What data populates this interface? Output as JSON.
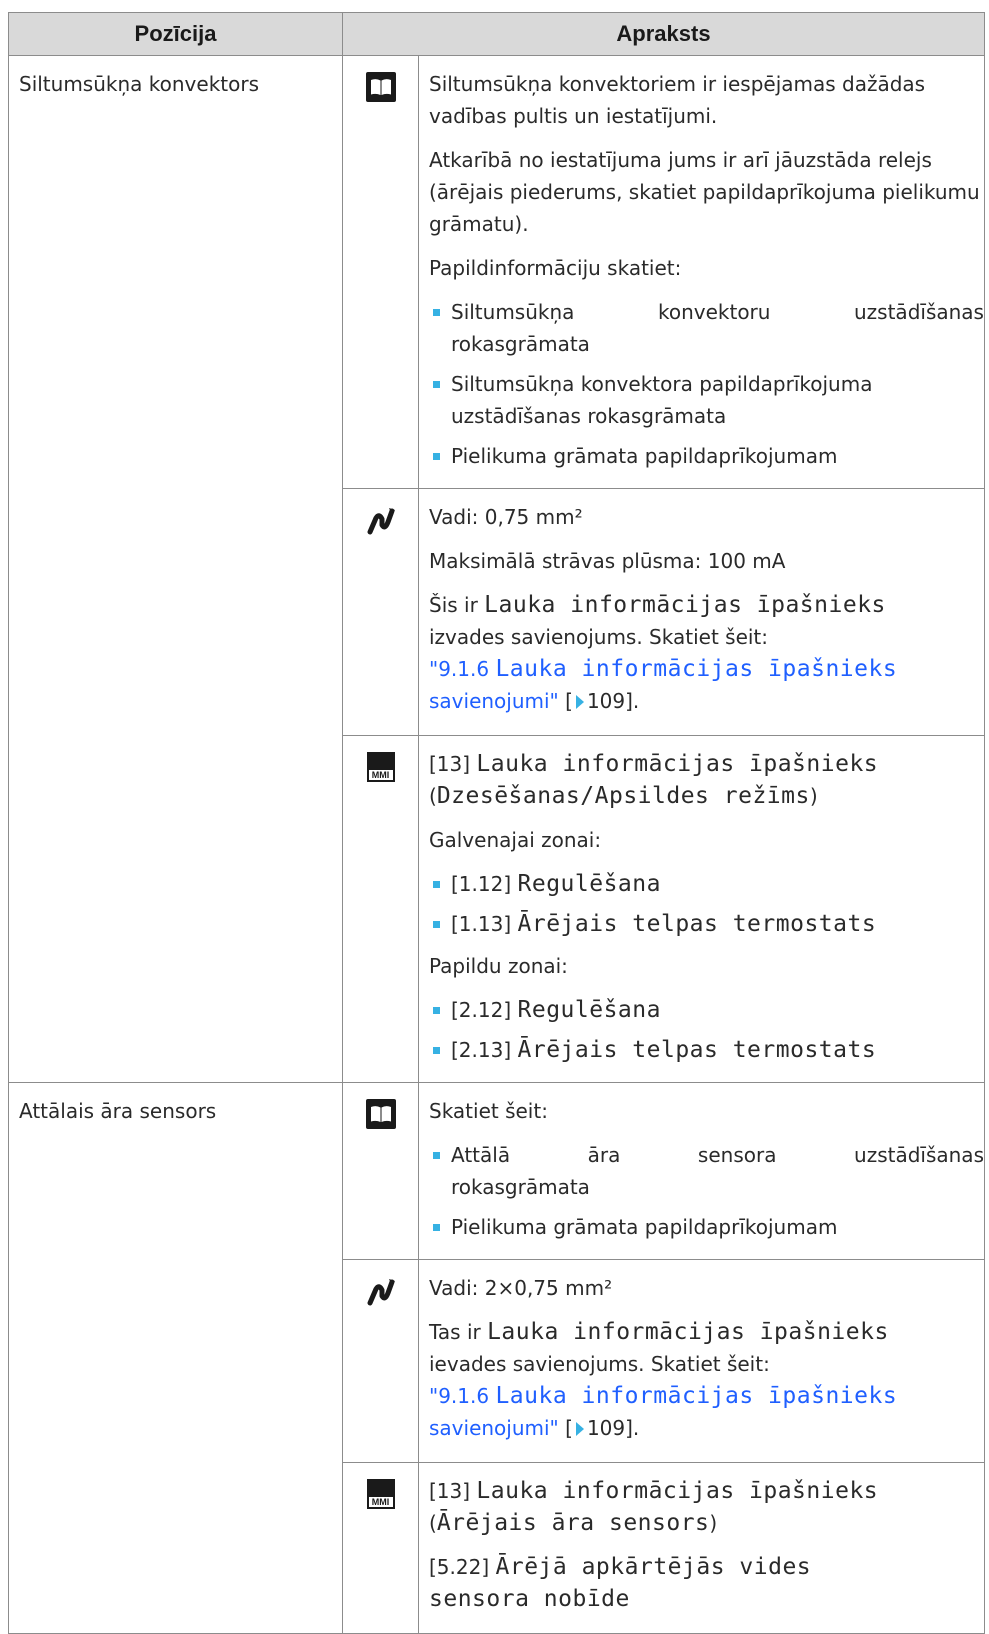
{
  "header": {
    "col1": "Pozīcija",
    "col2": "Apraksts"
  },
  "rows": [
    {
      "position": "Siltumsūkņa konvektors",
      "manual": {
        "icon": "manual-book-icon",
        "p1": "Siltumsūkņa konvektoriem ir iespējamas dažādas vadības pultis un iestatījumi.",
        "p2": "Atkarībā no iestatījuma jums ir arī jāuzstāda relejs (ārējais piederums, skatiet papildaprīkojuma pielikumu grāmatu).",
        "p3": "Papildinformāciju skatiet:",
        "b1a": "Siltumsūkņa",
        "b1b": "konvektoru",
        "b1c": "uzstādīšanas",
        "b1d": "rokasgrāmata",
        "b2a": "Siltumsūkņa konvektora papildaprīkojuma",
        "b2b": "uzstādīšanas rokasgrāmata",
        "b3": "Pielikuma grāmata papildaprīkojumam"
      },
      "wiring": {
        "icon": "wiring-icon",
        "wires": "Vadi: 0,75 mm²",
        "current": "Maksimālā strāvas plūsma: 100 mA",
        "this_is": "Šis ir",
        "field": "Lauka informācijas īpašnieks",
        "conn": "izvades savienojums. Skatiet šeit:",
        "link_num": "\"9.1.6",
        "link_field": "Lauka informācijas īpašnieks",
        "link_end": "savienojumi\"",
        "ref_open": "[",
        "ref_page": "109].",
        "ref_icon": "arrow-right-icon"
      },
      "mmi": {
        "icon": "mmi-display-icon",
        "icon_label": "MMI",
        "code": "[13]",
        "field": "Lauka informācijas īpašnieks",
        "sub_open": "(",
        "sub": "Dzesēšanas/Apsildes režīms",
        "sub_close": ")",
        "zone1": "Galvenajai zonai:",
        "z1a_code": "[1.12]",
        "z1a": "Regulēšana",
        "z1b_code": "[1.13]",
        "z1b": "Ārējais telpas termostats",
        "zone2": "Papildu zonai:",
        "z2a_code": "[2.12]",
        "z2a": "Regulēšana",
        "z2b_code": "[2.13]",
        "z2b": "Ārējais telpas termostats"
      }
    },
    {
      "position": "Attālais āra sensors",
      "manual": {
        "icon": "manual-book-icon",
        "p1": "Skatiet šeit:",
        "b1a": "Attālā",
        "b1b": "āra",
        "b1c": "sensora",
        "b1d": "uzstādīšanas",
        "b1e": "rokasgrāmata",
        "b2": "Pielikuma grāmata papildaprīkojumam"
      },
      "wiring": {
        "icon": "wiring-icon",
        "wires": "Vadi: 2×0,75 mm²",
        "this_is": "Tas ir",
        "field": "Lauka informācijas īpašnieks",
        "conn": "ievades savienojums. Skatiet šeit:",
        "link_num": "\"9.1.6",
        "link_field": "Lauka informācijas īpašnieks",
        "link_end": "savienojumi\"",
        "ref_open": "[",
        "ref_page": "109].",
        "ref_icon": "arrow-right-icon"
      },
      "mmi": {
        "icon": "mmi-display-icon",
        "icon_label": "MMI",
        "code": "[13]",
        "field": "Lauka informācijas īpašnieks",
        "sub_open": "(",
        "sub": "Ārējais āra sensors",
        "sub_close": ")",
        "code2": "[5.22]",
        "field2a": "Ārējā apkārtējās vides",
        "field2b": "sensora nobīde"
      }
    }
  ],
  "colors": {
    "bullet": "#36b1e3",
    "link": "#1f5fff",
    "header_bg": "#d9d9d9",
    "border": "#8c8c8c"
  }
}
